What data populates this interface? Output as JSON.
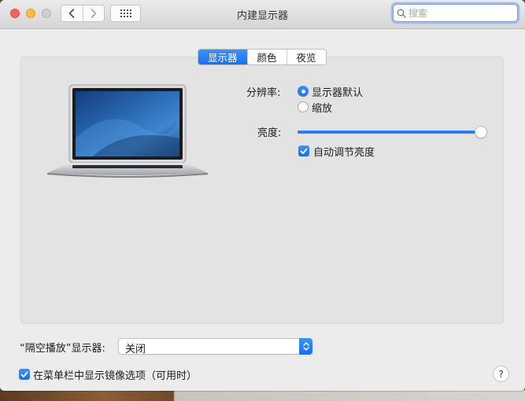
{
  "window": {
    "title": "内建显示器"
  },
  "toolbar": {
    "back_icon": "chevron-left-icon",
    "forward_icon": "chevron-right-icon",
    "grid_icon": "show-all-grid-icon"
  },
  "search": {
    "placeholder": "搜索"
  },
  "tabs": [
    {
      "label": "显示器",
      "active": true
    },
    {
      "label": "颜色",
      "active": false
    },
    {
      "label": "夜览",
      "active": false
    }
  ],
  "resolution": {
    "label": "分辨率:",
    "options": [
      {
        "label": "显示器默认",
        "selected": true
      },
      {
        "label": "缩放",
        "selected": false
      }
    ]
  },
  "brightness": {
    "label": "亮度:",
    "value": 1.0,
    "auto_label": "自动调节亮度",
    "auto_checked": true
  },
  "airplay": {
    "label": "“隔空播放”显示器:",
    "value": "关闭"
  },
  "mirroring": {
    "label": "在菜单栏中显示镜像选项（可用时）",
    "checked": true
  },
  "help": {
    "label": "?"
  },
  "colors": {
    "accent": "#1b6ef0",
    "close": "#fc605c",
    "minimize": "#fdbc40"
  }
}
